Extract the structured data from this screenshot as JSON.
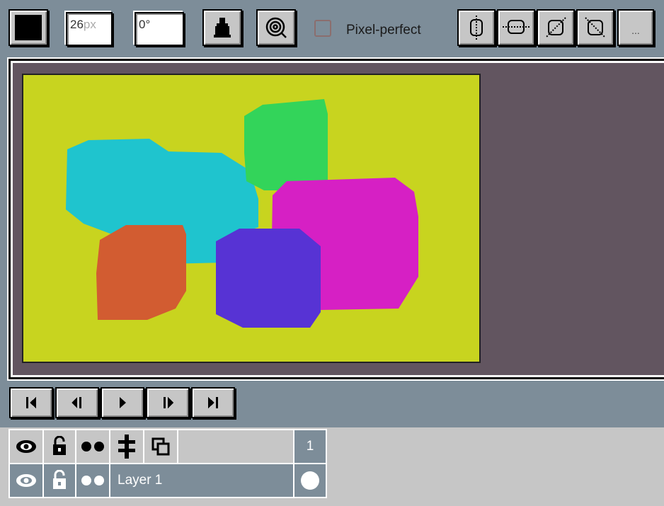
{
  "toolbar": {
    "color_swatch": "#000000",
    "brush_size_value": "26",
    "brush_size_unit": "px",
    "angle_value": "0°",
    "fill_tool_icon": "ink-bottle-icon",
    "symmetry_icon": "spiral-target-icon",
    "pixel_perfect_label": "Pixel-perfect",
    "pixel_perfect_checked": false,
    "shape_tools": [
      "flip-vertical-icon",
      "flip-horizontal-icon",
      "diagonal-icon",
      "antidiagonal-icon"
    ],
    "more_label": "..."
  },
  "canvas": {
    "background_color": "#c8d41f",
    "workspace_color": "#625560",
    "shape_colors": {
      "cyan": "#1fc4ce",
      "green": "#33d45a",
      "magenta": "#d620c4",
      "orange": "#d25c31",
      "purple": "#5733d4"
    }
  },
  "playback": {
    "buttons": [
      "first-frame-icon",
      "previous-frame-icon",
      "play-icon",
      "next-frame-icon",
      "last-frame-icon"
    ]
  },
  "layers": {
    "header_icons": [
      "visibility-eye-icon",
      "lock-icon",
      "onion-skin-icon",
      "merge-layers-icon",
      "duplicate-layer-icon"
    ],
    "frame_number": "1",
    "rows": [
      {
        "name": "Layer 1",
        "visible": true,
        "locked": false
      }
    ]
  }
}
